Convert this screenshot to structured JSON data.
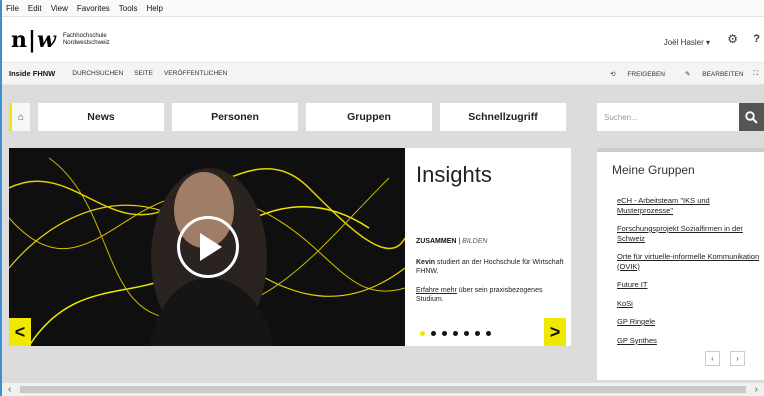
{
  "menu": [
    "File",
    "Edit",
    "View",
    "Favorites",
    "Tools",
    "Help"
  ],
  "logo": {
    "mark_left": "n",
    "mark_right": "w",
    "line1": "Fachhochschule",
    "line2": "Nordwestschweiz"
  },
  "header": {
    "user": "Joël Hasler",
    "user_caret": "▾"
  },
  "subnav": {
    "title": "Inside FHNW",
    "items": [
      "DURCHSUCHEN",
      "SEITE",
      "VERÖFFENTLICHEN"
    ],
    "share": "FREIGEBEN",
    "edit": "BEARBEITEN"
  },
  "topnav": {
    "items": [
      "News",
      "Personen",
      "Gruppen",
      "Schnellzugriff"
    ]
  },
  "search": {
    "placeholder": "Suchen..."
  },
  "insights": {
    "title": "Insights",
    "kicker_bold": "ZUSAMMEN",
    "kicker_sep": " | ",
    "kicker_italic": "BILDEN",
    "desc_name": "Kevin",
    "desc_rest": " studiert an der Hochschule für Wirtschaft FHNW.",
    "more_link": "Erfahre mehr",
    "more_rest": " über sein praxisbezogenes Studium.",
    "active_dot": 0,
    "dot_count": 7
  },
  "groups": {
    "title": "Meine Gruppen",
    "items": [
      "eCH - Arbeitsteam \"IKS und Musterprozesse\"",
      "Forschungsprojekt Sozialfirmen in der Schweiz",
      "Orte für virtuelle-informelle Kommunikation (OVIK)",
      "Future IT",
      "KoSi",
      "GP Ringele",
      "GP Synthes"
    ]
  },
  "colors": {
    "accent": "#f0e800",
    "hero_bg": "#0f0f0f",
    "search_btn": "#555555"
  }
}
